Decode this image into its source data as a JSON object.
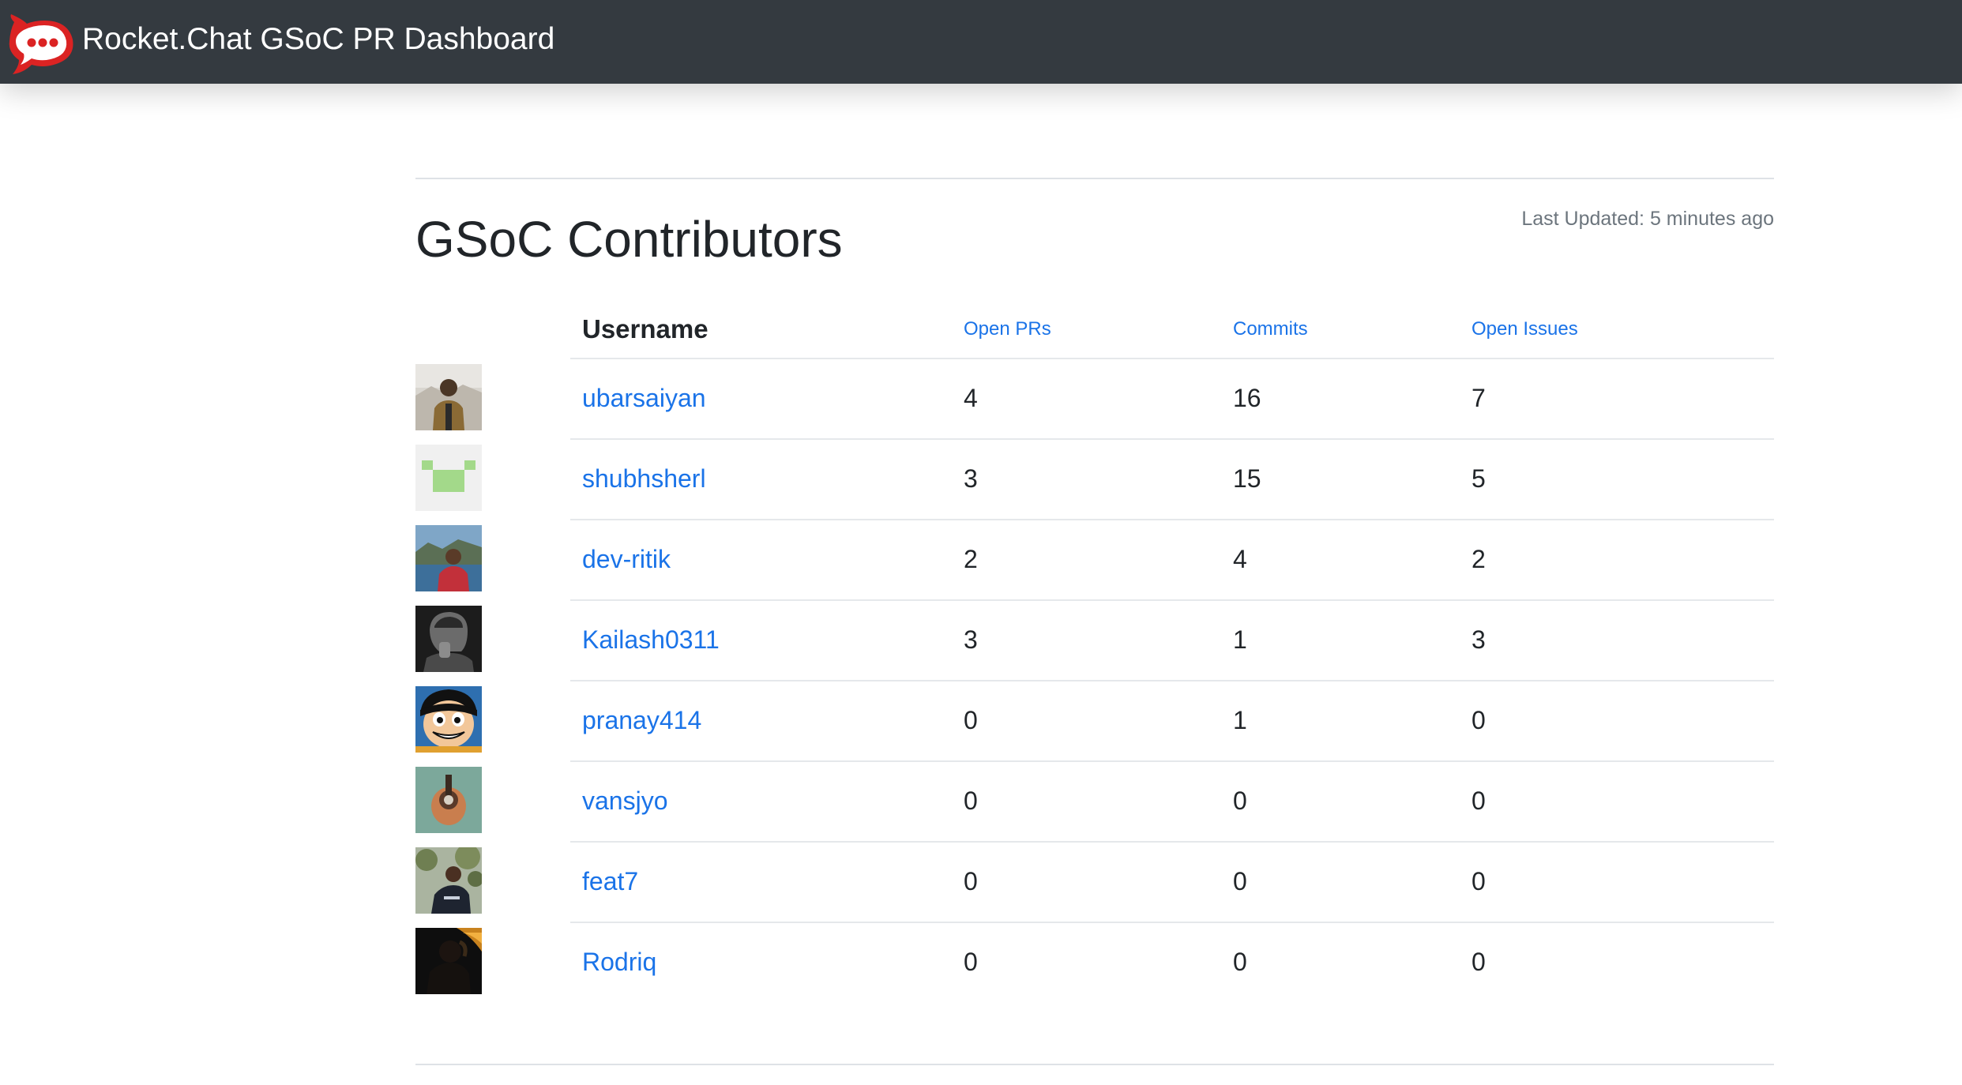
{
  "navbar": {
    "title": "Rocket.Chat GSoC PR Dashboard",
    "logo_icon": "rocketchat-logo-icon",
    "background_color": "#343a40",
    "logo_color": "#db2323"
  },
  "main": {
    "title": "GSoC Contributors",
    "last_updated": "Last Updated: 5 minutes ago"
  },
  "table": {
    "headers": {
      "username": "Username",
      "open_prs": "Open PRs",
      "commits": "Commits",
      "open_issues": "Open Issues"
    },
    "rows": [
      {
        "username": "ubarsaiyan",
        "open_prs": "4",
        "commits": "16",
        "open_issues": "7"
      },
      {
        "username": "shubhsherl",
        "open_prs": "3",
        "commits": "15",
        "open_issues": "5"
      },
      {
        "username": "dev-ritik",
        "open_prs": "2",
        "commits": "4",
        "open_issues": "2"
      },
      {
        "username": "Kailash0311",
        "open_prs": "3",
        "commits": "1",
        "open_issues": "3"
      },
      {
        "username": "pranay414",
        "open_prs": "0",
        "commits": "1",
        "open_issues": "0"
      },
      {
        "username": "vansjyo",
        "open_prs": "0",
        "commits": "0",
        "open_issues": "0"
      },
      {
        "username": "feat7",
        "open_prs": "0",
        "commits": "0",
        "open_issues": "0"
      },
      {
        "username": "Rodriq",
        "open_prs": "0",
        "commits": "0",
        "open_issues": "0"
      }
    ]
  },
  "colors": {
    "link": "#1a73e8",
    "text": "#212529",
    "muted": "#6c757d"
  }
}
